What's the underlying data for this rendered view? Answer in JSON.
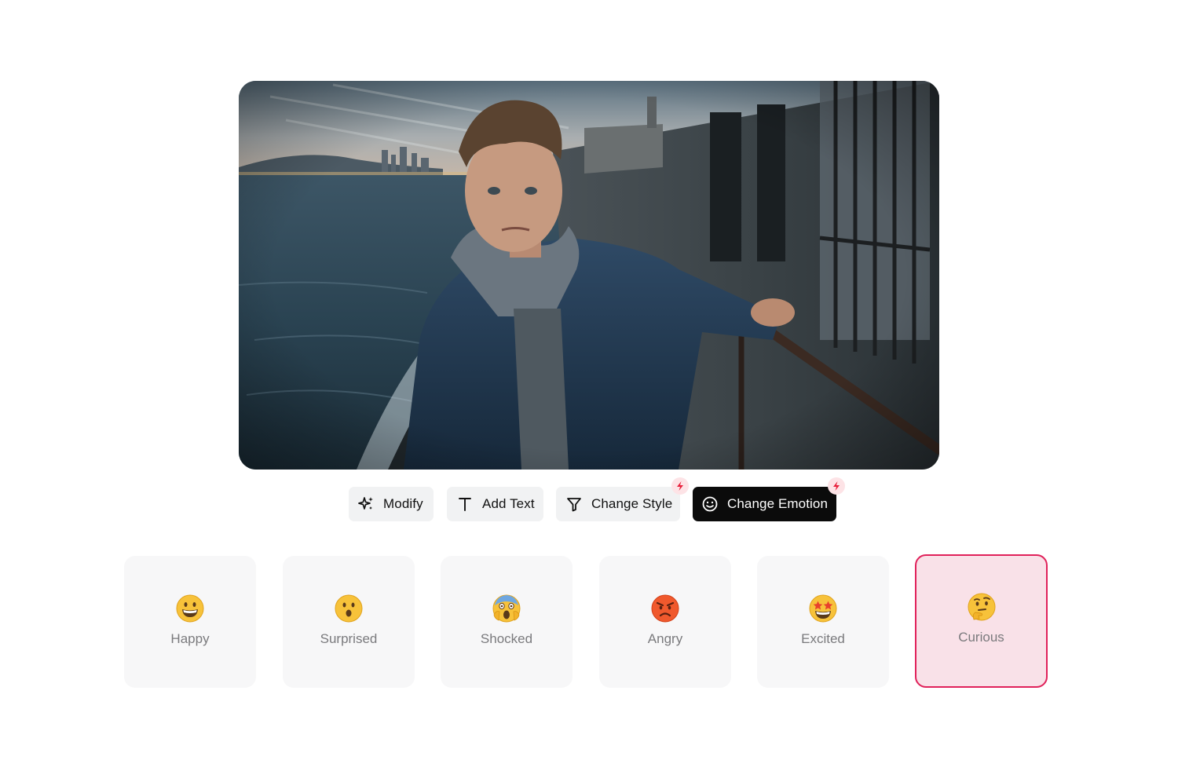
{
  "colors": {
    "accent": "#e0215a",
    "selected_card_bg": "#f9e1e8",
    "card_bg": "#f7f7f8",
    "tool_bg": "#f1f2f3",
    "active_tool_bg": "#0b0b0b",
    "badge_bolt": "#e8213c"
  },
  "toolbar": {
    "modify": {
      "label": "Modify",
      "icon": "sparkles-icon"
    },
    "add_text": {
      "label": "Add Text",
      "icon": "text-icon"
    },
    "change_style": {
      "label": "Change Style",
      "icon": "filter-icon",
      "badge": "lightning-icon"
    },
    "change_emotion": {
      "label": "Change Emotion",
      "icon": "smiley-icon",
      "badge": "lightning-icon",
      "active": true
    }
  },
  "emotions": [
    {
      "label": "Happy",
      "emoji": "grinning-face",
      "selected": false
    },
    {
      "label": "Surprised",
      "emoji": "hushed-face",
      "selected": false
    },
    {
      "label": "Shocked",
      "emoji": "screaming-face",
      "selected": false
    },
    {
      "label": "Angry",
      "emoji": "angry-face",
      "selected": false
    },
    {
      "label": "Excited",
      "emoji": "star-struck-face",
      "selected": false
    },
    {
      "label": "Curious",
      "emoji": "thinking-face",
      "selected": true
    }
  ]
}
